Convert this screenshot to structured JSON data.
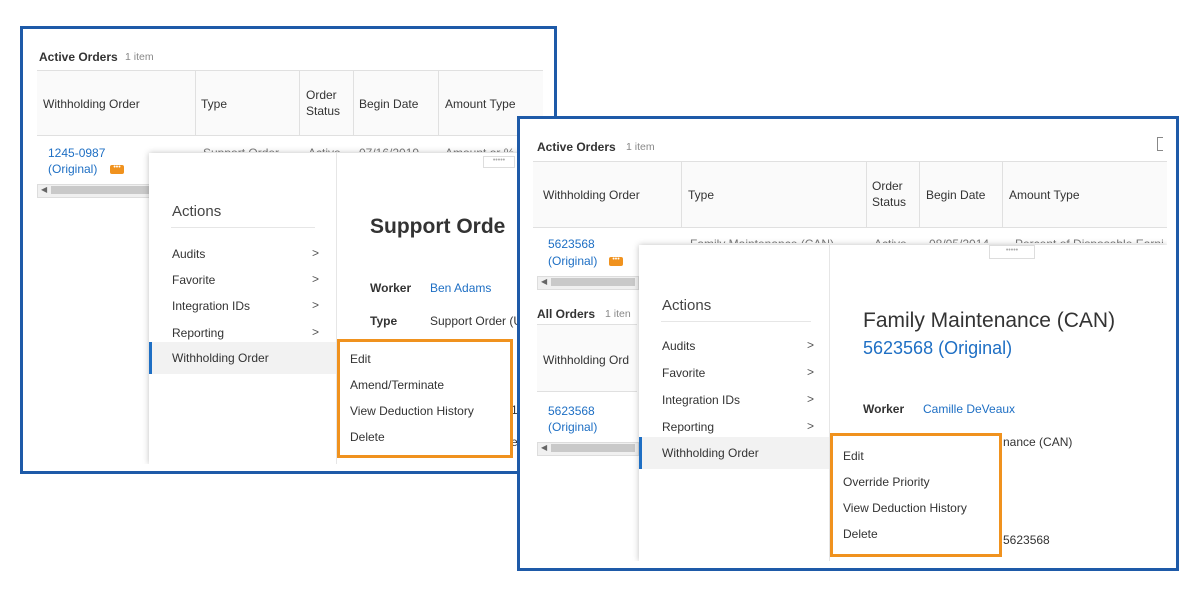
{
  "left": {
    "active_orders": {
      "title": "Active Orders",
      "count": "1 item"
    },
    "columns": [
      "Withholding Order",
      "Type",
      "Order",
      "Status",
      "Begin Date",
      "Amount Type"
    ],
    "row": {
      "order_id": "1245-0987",
      "order_tag": "(Original)",
      "type": "Support Order",
      "status": "Active",
      "begin": "07/16/2019",
      "amount": "Amount or %"
    },
    "actions": {
      "title": "Actions",
      "items": [
        "Audits",
        "Favorite",
        "Integration IDs",
        "Reporting",
        "Withholding Order"
      ]
    },
    "submenu": [
      "Edit",
      "Amend/Terminate",
      "View Deduction History",
      "Delete"
    ],
    "detail": {
      "title": "Support Orde",
      "worker_label": "Worker",
      "worker_value": "Ben Adams",
      "type_label": "Type",
      "type_value": "Support Order (U",
      "frag1": "1",
      "frag2": "e"
    }
  },
  "right": {
    "active_orders": {
      "title": "Active Orders",
      "count": "1 item"
    },
    "columns": [
      "Withholding Order",
      "Type",
      "Order",
      "Status",
      "Begin Date",
      "Amount Type"
    ],
    "row": {
      "order_id": "5623568",
      "order_tag": "(Original)",
      "type": "Family Maintenance (CAN)",
      "status": "Active",
      "begin": "08/05/2014",
      "amount": "Percent of Disposable Earni"
    },
    "all_orders": {
      "title": "All Orders",
      "count": "1 iten"
    },
    "all_col": "Withholding Ord",
    "all_row": {
      "order_id": "5623568",
      "order_tag": "(Original)"
    },
    "actions": {
      "title": "Actions",
      "items": [
        "Audits",
        "Favorite",
        "Integration IDs",
        "Reporting",
        "Withholding Order"
      ]
    },
    "submenu": [
      "Edit",
      "Override Priority",
      "View Deduction History",
      "Delete"
    ],
    "detail": {
      "title": "Family Maintenance (CAN)",
      "subtitle": "5623568 (Original)",
      "worker_label": "Worker",
      "worker_value": "Camille DeVeaux",
      "type_frag": "nance (CAN)",
      "id_frag": "5623568"
    }
  },
  "colors": {
    "frame": "#1e5aa8",
    "highlight": "#f0921e",
    "link": "#1e6fc4"
  }
}
